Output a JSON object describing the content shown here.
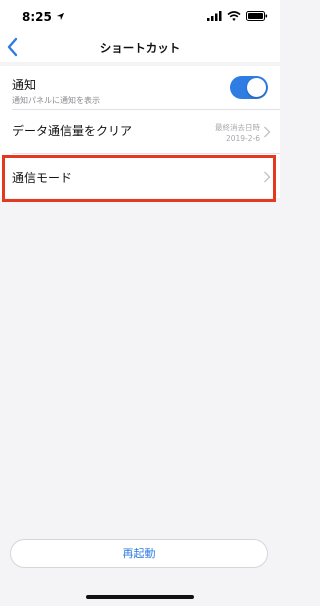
{
  "status_bar": {
    "time": "8:25",
    "icons": [
      "location-arrow-icon",
      "signal-icon",
      "wifi-icon",
      "battery-icon"
    ]
  },
  "nav": {
    "title": "ショートカット",
    "back_icon": "chevron-left-icon"
  },
  "rows": [
    {
      "title": "通知",
      "subtitle": "通知パネルに通知を表示",
      "toggle_on": true
    },
    {
      "title": "データ通信量をクリア",
      "meta_label": "最終消去日時",
      "meta_value": "2019-2-6"
    },
    {
      "title": "通信モード"
    }
  ],
  "restart_label": "再起動",
  "colors": {
    "accent": "#2f7ce2",
    "highlight": "#e33a1f",
    "background": "#f4f4f6"
  }
}
